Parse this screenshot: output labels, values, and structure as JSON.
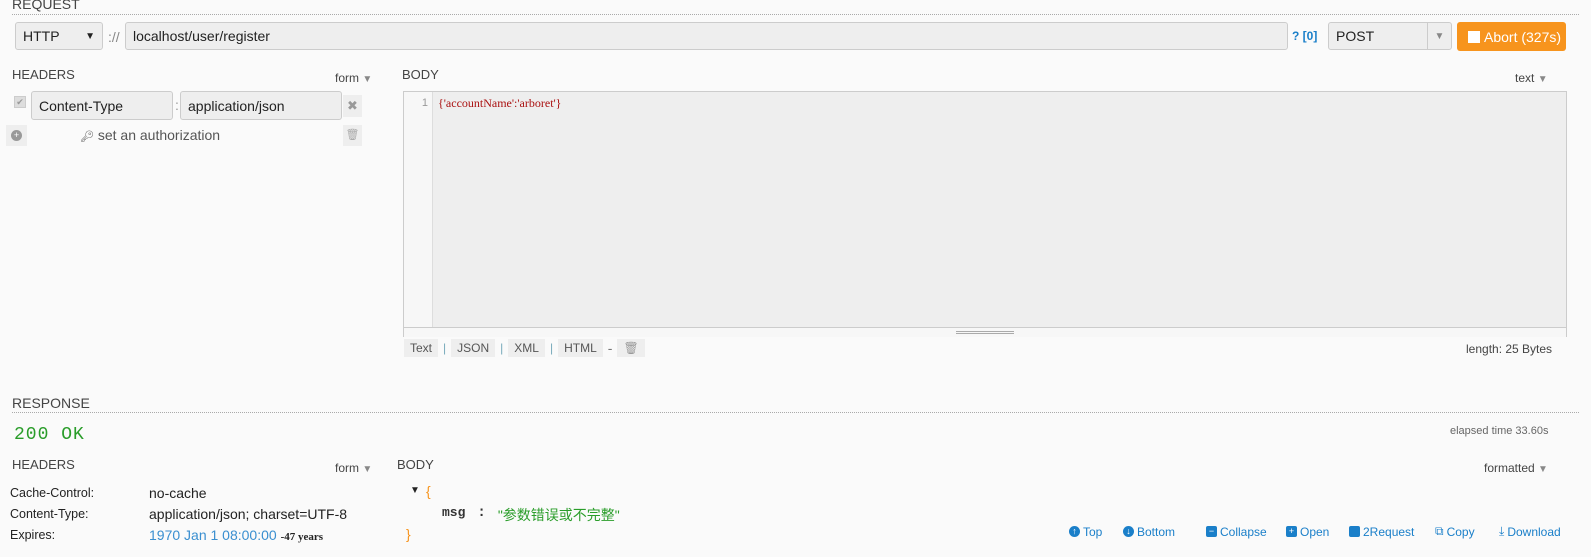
{
  "request": {
    "title": "REQUEST",
    "scheme": "HTTP",
    "sep": "://",
    "url": "localhost/user/register",
    "help": "? [0]",
    "method": "POST",
    "abort": "Abort (327s)"
  },
  "req_headers": {
    "title": "HEADERS",
    "mode": "form",
    "items": [
      {
        "name": "Content-Type",
        "value": "application/json"
      }
    ],
    "auth": "set an authorization"
  },
  "req_body": {
    "title": "BODY",
    "mode": "text",
    "line": "1",
    "content": "{'accountName':'arboret'}",
    "formats": [
      "Text",
      "JSON",
      "XML",
      "HTML"
    ],
    "length": "length: 25 Bytes"
  },
  "response": {
    "title": "RESPONSE",
    "status": "200 OK",
    "elapsed": "elapsed time 33.60s"
  },
  "res_headers": {
    "title": "HEADERS",
    "mode": "form",
    "items": [
      {
        "name": "Cache-Control:",
        "value": "no-cache"
      },
      {
        "name": "Content-Type:",
        "value": "application/json; charset=UTF-8"
      },
      {
        "name": "Expires:",
        "value": "1970 Jan 1 08:00:00",
        "extra": "-47 years"
      }
    ]
  },
  "res_body": {
    "title": "BODY",
    "mode": "formatted",
    "key": "msg",
    "value": "\"参数错误或不完整\""
  },
  "actions": [
    "Top",
    "Bottom",
    "Collapse",
    "Open",
    "2Request",
    "Copy",
    "Download"
  ],
  "colors": {
    "accent": "#1a7fc9",
    "abort": "#f7941d",
    "status": "#2a9d2a"
  }
}
